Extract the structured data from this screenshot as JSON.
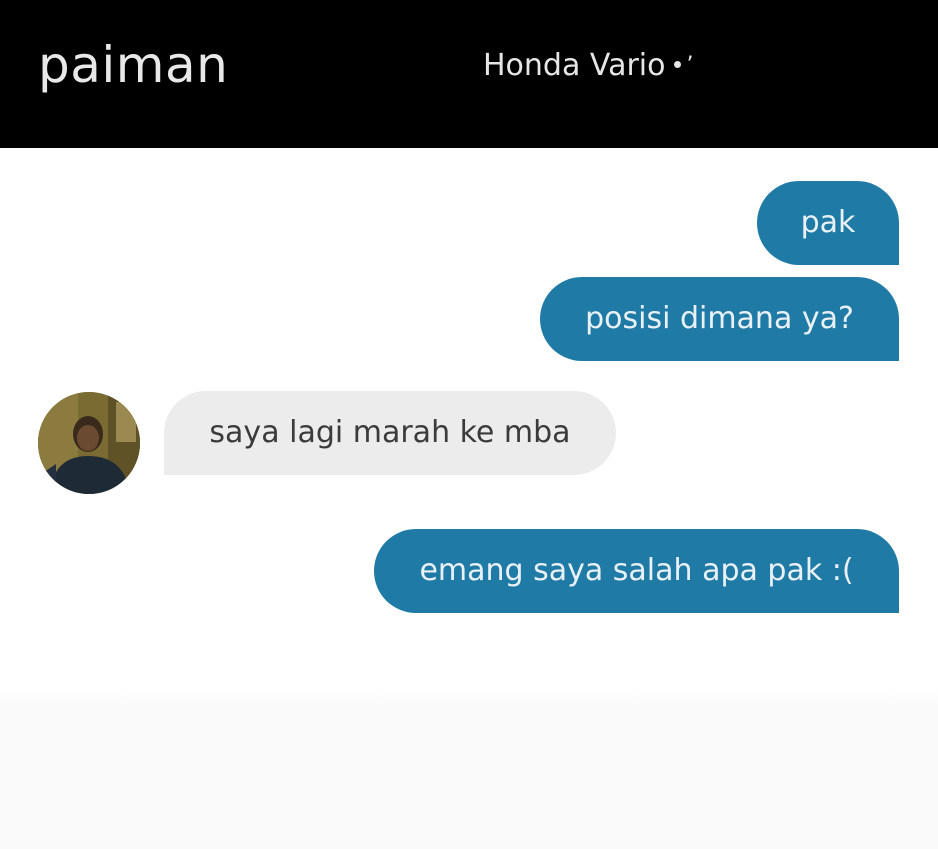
{
  "header": {
    "contact_name": "paiman",
    "vehicle": "Honda Vario",
    "vehicle_suffix": "’"
  },
  "messages": [
    {
      "direction": "outgoing",
      "text": "pak"
    },
    {
      "direction": "outgoing",
      "text": "posisi dimana ya?"
    },
    {
      "direction": "incoming",
      "text": "saya lagi marah ke mba"
    },
    {
      "direction": "outgoing",
      "text": "emang saya salah apa pak :("
    }
  ],
  "colors": {
    "header_bg": "#000000",
    "outgoing_bubble": "#1f7ba6",
    "incoming_bubble": "#ececec"
  }
}
